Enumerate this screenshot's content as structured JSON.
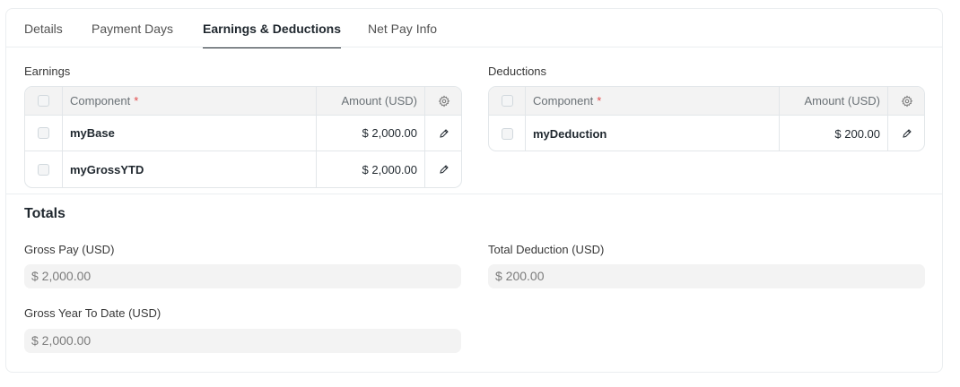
{
  "tabs": [
    {
      "label": "Details"
    },
    {
      "label": "Payment Days"
    },
    {
      "label": "Earnings & Deductions"
    },
    {
      "label": "Net Pay Info"
    }
  ],
  "earnings": {
    "title": "Earnings",
    "columns": {
      "component": "Component",
      "required_mark": "*",
      "amount": "Amount (USD)"
    },
    "rows": [
      {
        "component": "myBase",
        "amount": "$ 2,000.00"
      },
      {
        "component": "myGrossYTD",
        "amount": "$ 2,000.00"
      }
    ]
  },
  "deductions": {
    "title": "Deductions",
    "columns": {
      "component": "Component",
      "required_mark": "*",
      "amount": "Amount (USD)"
    },
    "rows": [
      {
        "component": "myDeduction",
        "amount": "$ 200.00"
      }
    ]
  },
  "totals": {
    "title": "Totals",
    "gross_pay": {
      "label": "Gross Pay (USD)",
      "value": "$ 2,000.00"
    },
    "total_deduction": {
      "label": "Total Deduction (USD)",
      "value": "$ 200.00"
    },
    "gross_ytd": {
      "label": "Gross Year To Date (USD)",
      "value": "$ 2,000.00"
    }
  },
  "icons": {
    "settings": "gear-icon",
    "edit": "pencil-icon",
    "checkbox": "checkbox"
  },
  "colors": {
    "required": "#e24c4c",
    "active_tab_underline": "#1f272e"
  }
}
